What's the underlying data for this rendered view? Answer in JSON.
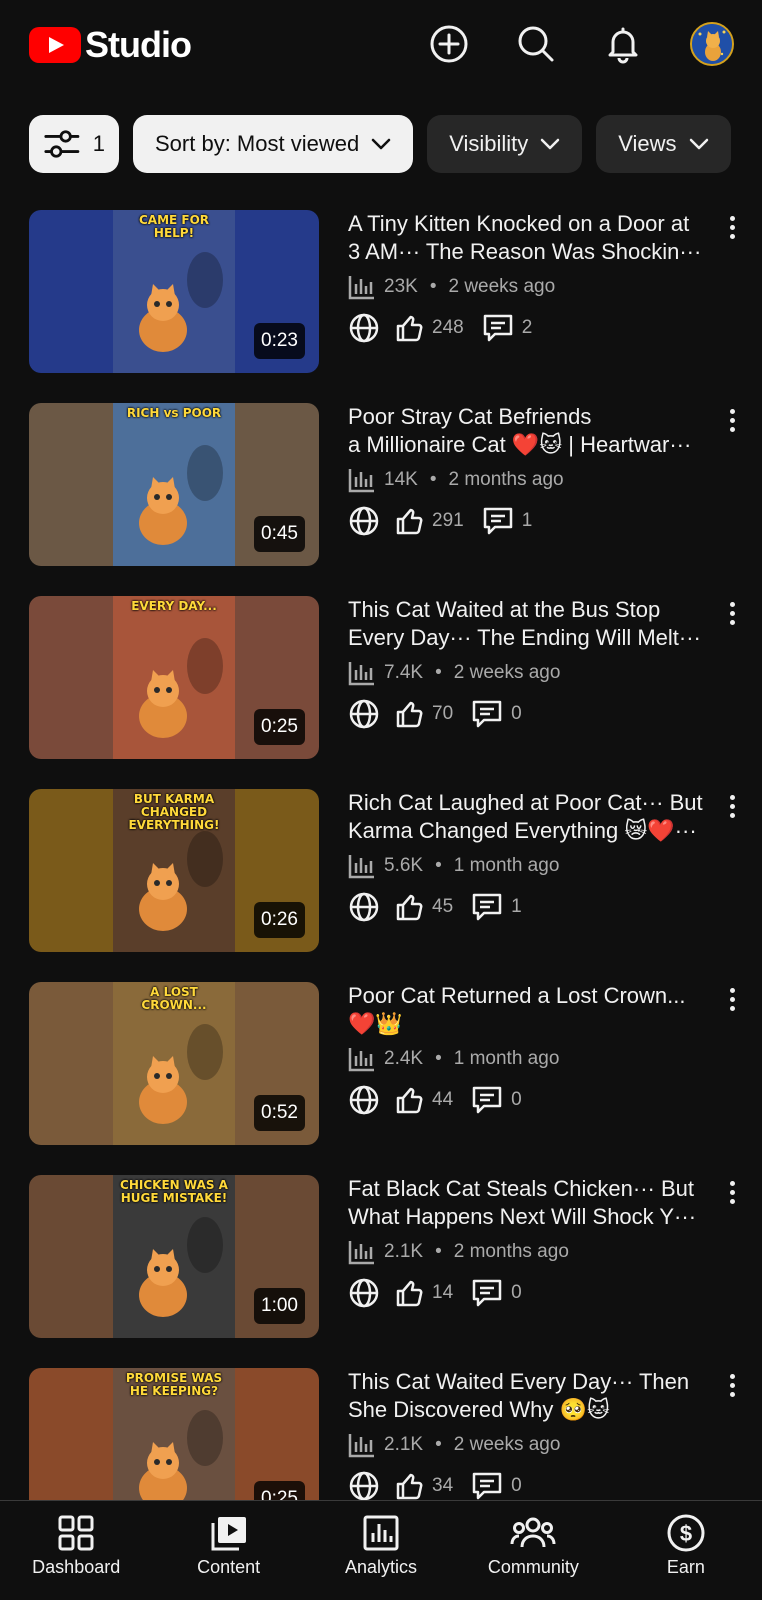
{
  "app": {
    "logo_text": "Studio"
  },
  "filters": {
    "filter_count": "1",
    "chips": [
      {
        "label": "Sort by: Most viewed",
        "active": true
      },
      {
        "label": "Visibility",
        "active": false
      },
      {
        "label": "Views",
        "active": false
      }
    ]
  },
  "videos": [
    {
      "title_line1": "A Tiny Kitten Knocked on a Door at",
      "title_line2": "3 AM··· The Reason Was Shockin···",
      "views": "23K",
      "age": "2 weeks ago",
      "likes": "248",
      "comments": "2",
      "duration": "0:23",
      "thumb_overlay": "CAME FOR HELP!",
      "thumb_bg": "#253a8a",
      "thumb_main": "#3a4f8f"
    },
    {
      "title_line1": "Poor Stray Cat Befriends",
      "title_line2": "a Millionaire Cat ❤️🐱 | Heartwar···",
      "views": "14K",
      "age": "2 months ago",
      "likes": "291",
      "comments": "1",
      "duration": "0:45",
      "thumb_overlay": "RICH vs POOR",
      "thumb_bg": "#6b5845",
      "thumb_main": "#4d6f9a"
    },
    {
      "title_line1": "This Cat Waited at the Bus Stop",
      "title_line2": "Every Day··· The Ending Will Melt···",
      "views": "7.4K",
      "age": "2 weeks ago",
      "likes": "70",
      "comments": "0",
      "duration": "0:25",
      "thumb_overlay": "EVERY DAY...",
      "thumb_bg": "#7a4a3a",
      "thumb_main": "#a8553a"
    },
    {
      "title_line1": "Rich Cat Laughed at Poor Cat··· But",
      "title_line2": "Karma Changed Everything 😿❤️···",
      "views": "5.6K",
      "age": "1 month ago",
      "likes": "45",
      "comments": "1",
      "duration": "0:26",
      "thumb_overlay": "BUT KARMA CHANGED EVERYTHING!",
      "thumb_bg": "#7a5a1a",
      "thumb_main": "#5a3e2a"
    },
    {
      "title_line1": "Poor Cat Returned a Lost Crown...",
      "title_line2": "❤️👑",
      "views": "2.4K",
      "age": "1 month ago",
      "likes": "44",
      "comments": "0",
      "duration": "0:52",
      "thumb_overlay": "A LOST CROWN...",
      "thumb_bg": "#7a5a3a",
      "thumb_main": "#8a6a3a"
    },
    {
      "title_line1": "Fat Black Cat Steals Chicken··· But",
      "title_line2": "What Happens Next Will Shock Y···",
      "views": "2.1K",
      "age": "2 months ago",
      "likes": "14",
      "comments": "0",
      "duration": "1:00",
      "thumb_overlay": "CHICKEN WAS A HUGE MISTAKE!",
      "thumb_bg": "#6a4a34",
      "thumb_main": "#3a3a3a"
    },
    {
      "title_line1": "This Cat Waited Every Day··· Then",
      "title_line2": "She Discovered Why 🥺🐱",
      "views": "2.1K",
      "age": "2 weeks ago",
      "likes": "34",
      "comments": "0",
      "duration": "0:25",
      "thumb_overlay": "PROMISE WAS HE KEEPING?",
      "thumb_bg": "#8a4a2a",
      "thumb_main": "#6a5040"
    }
  ],
  "nav": [
    {
      "label": "Dashboard",
      "icon": "dashboard-icon"
    },
    {
      "label": "Content",
      "icon": "content-icon"
    },
    {
      "label": "Analytics",
      "icon": "analytics-icon"
    },
    {
      "label": "Community",
      "icon": "community-icon"
    },
    {
      "label": "Earn",
      "icon": "earn-icon"
    }
  ],
  "colors": {
    "background": "#0f0f0f",
    "brand_red": "#ff0000",
    "chip_active": "#f1f1f1",
    "chip": "#272727"
  }
}
